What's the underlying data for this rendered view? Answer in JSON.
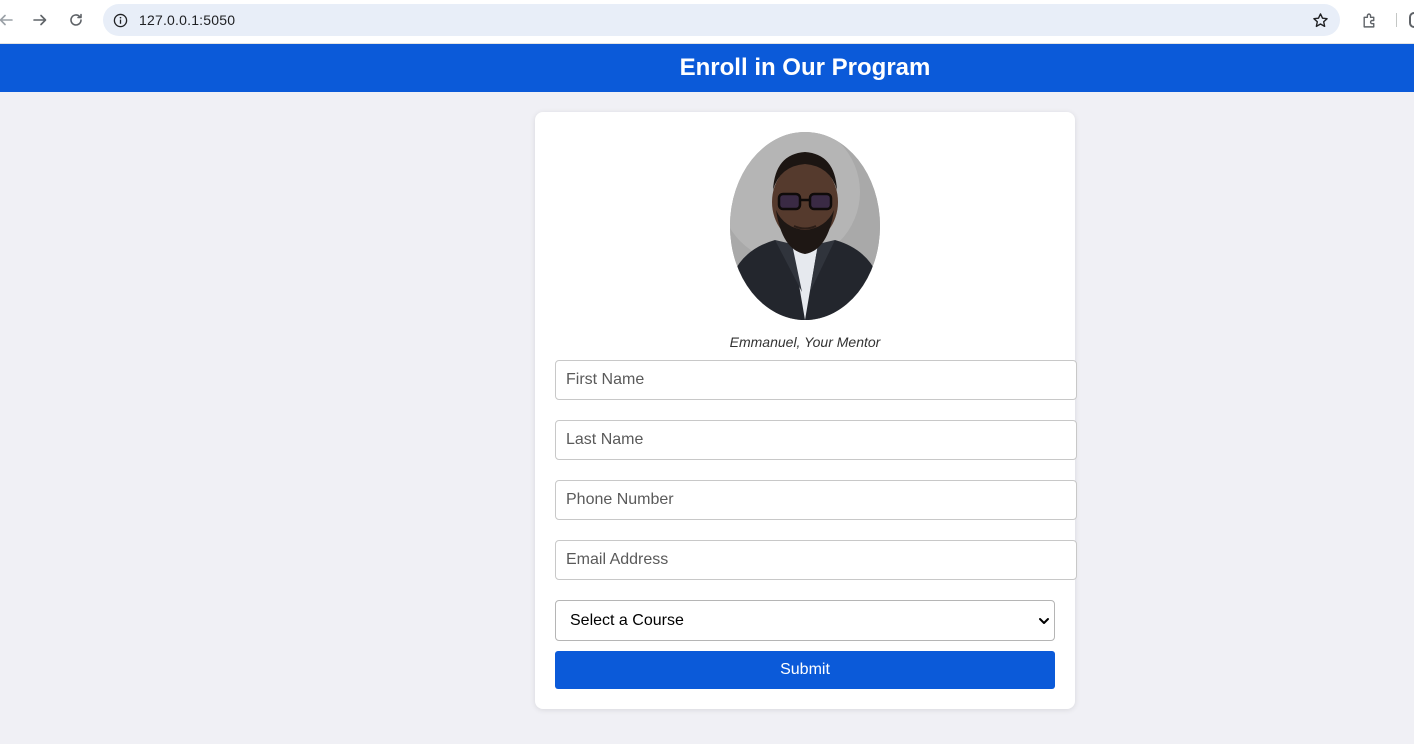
{
  "browser": {
    "url": "127.0.0.1:5050",
    "icons": {
      "back": "back-arrow-icon",
      "forward": "forward-arrow-icon",
      "reload": "reload-icon",
      "site_info": "info-icon",
      "bookmark": "star-icon",
      "extensions": "puzzle-icon"
    }
  },
  "header": {
    "title": "Enroll in Our Program",
    "background": "#0b5ad9"
  },
  "card": {
    "photo_alt": "Emmanuel, Your Mentor",
    "caption": "Emmanuel, Your Mentor",
    "form": {
      "first_name": {
        "placeholder": "First Name",
        "value": ""
      },
      "last_name": {
        "placeholder": "Last Name",
        "value": ""
      },
      "phone": {
        "placeholder": "Phone Number",
        "value": ""
      },
      "email": {
        "placeholder": "Email Address",
        "value": ""
      },
      "course_select": {
        "selected": "Select a Course"
      },
      "submit_label": "Submit"
    }
  },
  "colors": {
    "accent": "#0b5ad9",
    "page_background": "#f0f0f5",
    "card_background": "#ffffff"
  }
}
